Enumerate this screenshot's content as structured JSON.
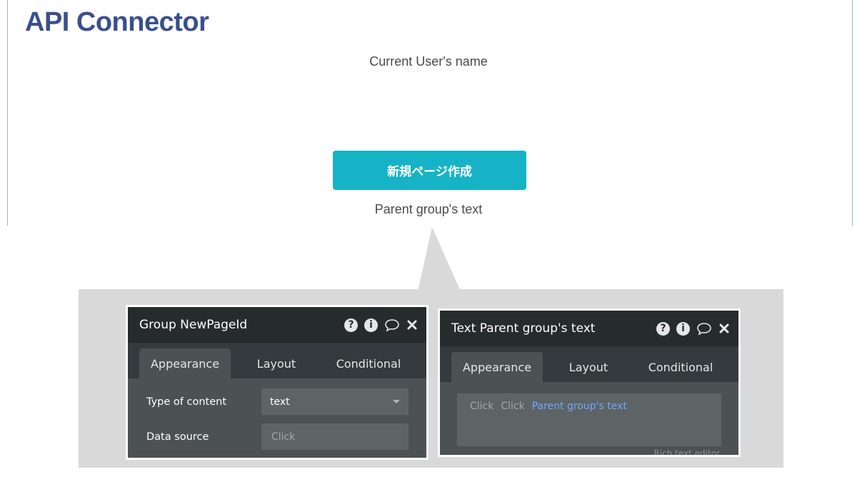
{
  "canvas": {
    "title": "API Connector",
    "user_name_text": "Current User's name",
    "button_label": "新規ページ作成",
    "parent_text": "Parent group's text"
  },
  "panels": [
    {
      "title": "Group NewPageId",
      "tabs": [
        "Appearance",
        "Layout",
        "Conditional"
      ],
      "active_tab": "Appearance",
      "properties": [
        {
          "label": "Type of content",
          "value": "text",
          "control": "select"
        },
        {
          "label": "Data source",
          "placeholder": "Click",
          "control": "input"
        }
      ]
    },
    {
      "title": "Text Parent group's text",
      "tabs": [
        "Appearance",
        "Layout",
        "Conditional"
      ],
      "active_tab": "Appearance",
      "rich_text": {
        "chips": [
          "Click",
          "Click"
        ],
        "expression": "Parent group's text",
        "caption": "Rich text editor"
      }
    }
  ],
  "icons": {
    "help": "question-icon",
    "info": "info-icon",
    "comment": "comment-icon",
    "close": "close-icon"
  },
  "colors": {
    "title": "#3b4f8f",
    "button": "#16b3c6",
    "panel_header": "#262b2e",
    "panel_body": "#4c5154",
    "link": "#6ea8ff",
    "callout": "#d9d9d9"
  }
}
